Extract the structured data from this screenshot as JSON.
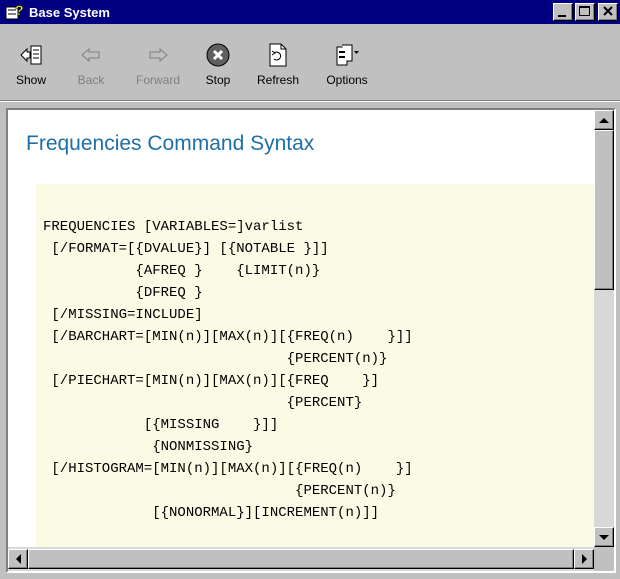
{
  "window": {
    "title": "Base System",
    "title_bar_color": "#000080",
    "icon": "help-book-icon"
  },
  "title_buttons": [
    {
      "icon": "minimize-icon"
    },
    {
      "icon": "maximize-icon"
    },
    {
      "icon": "close-icon"
    }
  ],
  "toolbar": {
    "show": {
      "label": "Show",
      "icon": "show-pane-icon",
      "enabled": true
    },
    "back": {
      "label": "Back",
      "icon": "back-arrow-icon",
      "enabled": false
    },
    "forward": {
      "label": "Forward",
      "icon": "forward-arrow-icon",
      "enabled": false
    },
    "stop": {
      "label": "Stop",
      "icon": "stop-icon",
      "enabled": true
    },
    "refresh": {
      "label": "Refresh",
      "icon": "refresh-icon",
      "enabled": true
    },
    "options": {
      "label": "Options",
      "icon": "options-icon",
      "enabled": true
    }
  },
  "page": {
    "heading": "Frequencies Command Syntax",
    "heading_color": "#1e6fa8",
    "code_background": "#fbfbe5",
    "code_lines": [
      "FREQUENCIES [VARIABLES=]varlist",
      " [/FORMAT=[{DVALUE}] [{NOTABLE }]]",
      "           {AFREQ }    {LIMIT(n)}",
      "           {DFREQ }",
      " [/MISSING=INCLUDE]",
      " [/BARCHART=[MIN(n)][MAX(n)][{FREQ(n)    }]]",
      "                             {PERCENT(n)}",
      " [/PIECHART=[MIN(n)][MAX(n)][{FREQ    }]",
      "                             {PERCENT}",
      "            [{MISSING    }]]",
      "             {NONMISSING}",
      " [/HISTOGRAM=[MIN(n)][MAX(n)][{FREQ(n)    }]",
      "                              {PERCENT(n)}",
      "             [{NONORMAL}][INCREMENT(n)]]"
    ]
  },
  "scroll": {
    "vertical_position": 0,
    "horizontal_position": 0
  }
}
